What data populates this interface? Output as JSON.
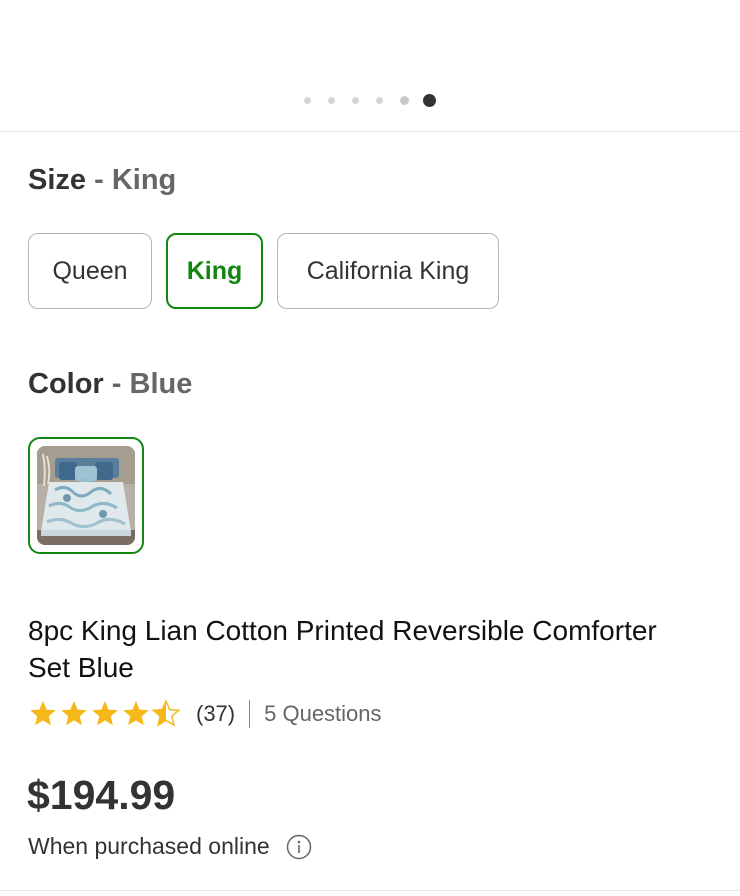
{
  "carousel": {
    "dot_count": 6,
    "active_index": 5
  },
  "size": {
    "label": "Size",
    "separator": "-",
    "selected": "King",
    "options": [
      "Queen",
      "King",
      "California King"
    ]
  },
  "color": {
    "label": "Color",
    "separator": "-",
    "selected": "Blue",
    "swatch_icon": "comforter-thumbnail"
  },
  "product": {
    "title": "8pc King Lian Cotton Printed Reversible Comforter Set Blue"
  },
  "rating": {
    "value": 4.5,
    "max": 5,
    "count_text": "(37)",
    "questions_text": "5 Questions",
    "star_color": "#f5b81b"
  },
  "price": {
    "amount": "$194.99",
    "note": "When purchased online"
  },
  "colors": {
    "accent_green": "#118611",
    "text_dark": "#333333",
    "text_muted": "#666666"
  }
}
